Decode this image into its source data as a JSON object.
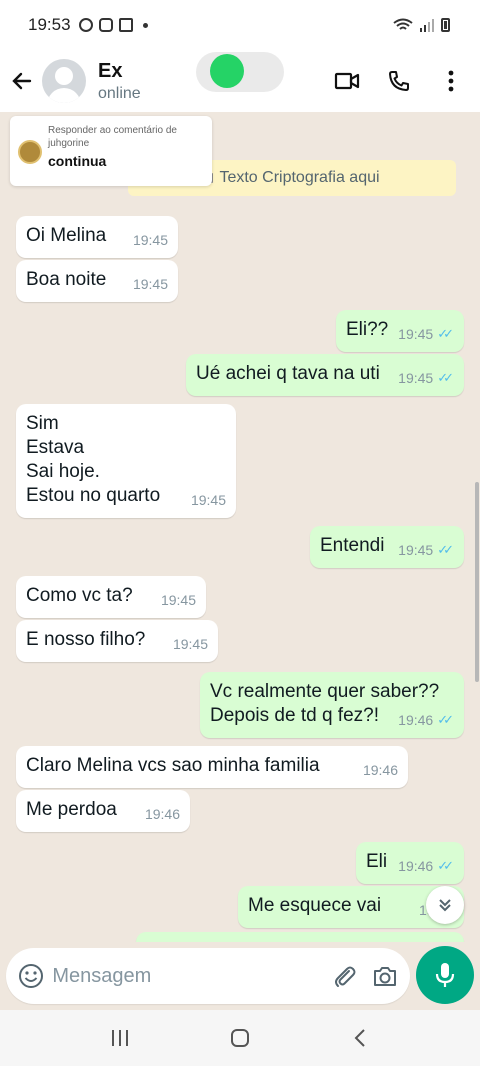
{
  "status_bar": {
    "time": "19:53"
  },
  "header": {
    "name": "Ex",
    "status": "online"
  },
  "reply_card": {
    "subtitle": "Responder ao comentário de juhgorine",
    "text": "continua"
  },
  "encryption_notice": "Texto Criptografia aqui",
  "messages": [
    {
      "dir": "in",
      "text": "Oi Melina",
      "time": "19:45"
    },
    {
      "dir": "in",
      "text": "Boa noite",
      "time": "19:45"
    },
    {
      "dir": "out",
      "text": "Eli??",
      "time": "19:45"
    },
    {
      "dir": "out",
      "text": "Ué achei q tava na uti",
      "time": "19:45"
    },
    {
      "dir": "in",
      "text": "Sim\nEstava\nSai hoje.\nEstou no quarto",
      "time": "19:45"
    },
    {
      "dir": "out",
      "text": "Entendi",
      "time": "19:45"
    },
    {
      "dir": "in",
      "text": "Como vc ta?",
      "time": "19:45"
    },
    {
      "dir": "in",
      "text": "E nosso filho?",
      "time": "19:45"
    },
    {
      "dir": "out",
      "text": "Vc realmente quer saber??\nDepois de td q fez?!",
      "time": "19:46"
    },
    {
      "dir": "in",
      "text": "Claro Melina vcs sao minha familia",
      "time": "19:46"
    },
    {
      "dir": "in",
      "text": "Me perdoa",
      "time": "19:46"
    },
    {
      "dir": "out",
      "text": "Eli",
      "time": "19:46"
    },
    {
      "dir": "out",
      "text": "Me esquece vai",
      "time": "19:46"
    }
  ],
  "input": {
    "placeholder": "Mensagem"
  },
  "colors": {
    "accent": "#00a884",
    "outgoing": "#d9fdd3",
    "incoming": "#ffffff",
    "tick": "#53bdeb"
  }
}
